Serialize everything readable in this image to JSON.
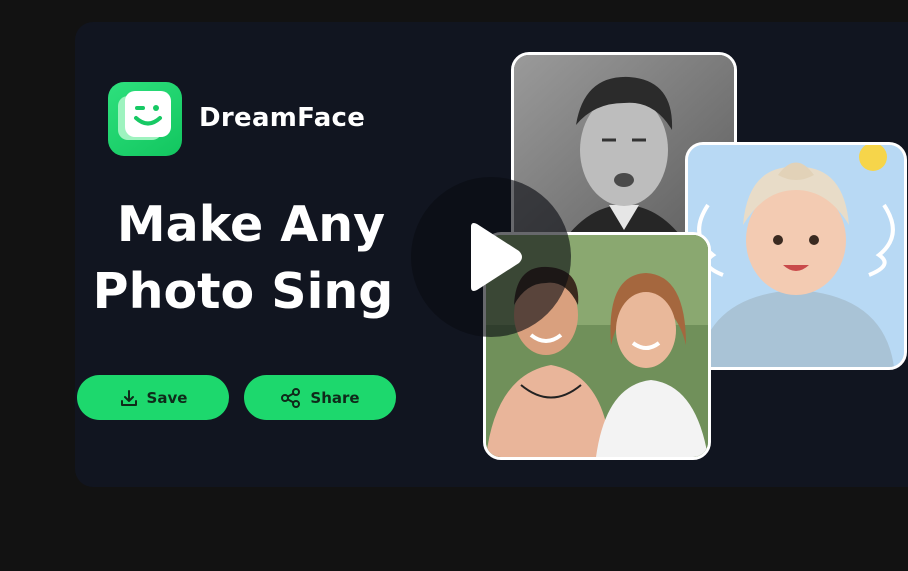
{
  "app": {
    "brand_name": "DreamFace",
    "logo_icon": "winking-face-logo"
  },
  "hero": {
    "headline_line1": "Make Any",
    "headline_line2": "Photo Sing"
  },
  "actions": {
    "save_label": "Save",
    "save_icon": "download-icon",
    "share_label": "Share",
    "share_icon": "share-icon"
  },
  "media": {
    "play_icon": "play-icon",
    "photos": [
      "vintage-portrait-photo",
      "baby-with-angel-wings-photo",
      "smiling-couple-photo"
    ]
  },
  "colors": {
    "accent": "#1dd86d",
    "card_background": "#111520",
    "page_background": "#121212"
  }
}
